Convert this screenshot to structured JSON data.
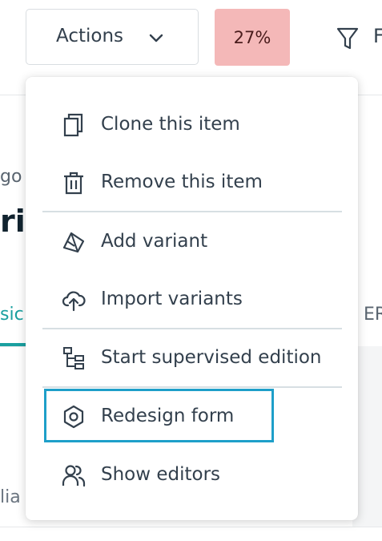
{
  "toolbar": {
    "actions_label": "Actions",
    "completion": "27%",
    "filter_label": "F",
    "completion_color": "#f4b8b8"
  },
  "background": {
    "breadcrumb": "go c",
    "title": "ri",
    "tab_active": "sic",
    "tab_right": "ER",
    "field": "lia"
  },
  "menu": {
    "items": [
      {
        "label": "Clone this item",
        "icon": "clone-icon"
      },
      {
        "label": "Remove this item",
        "icon": "trash-icon"
      },
      {
        "label": "Add variant",
        "icon": "variant-icon"
      },
      {
        "label": "Import variants",
        "icon": "cloud-upload-icon"
      },
      {
        "label": "Start supervised edition",
        "icon": "hierarchy-icon"
      },
      {
        "label": "Redesign form",
        "icon": "hexagon-icon"
      },
      {
        "label": "Show editors",
        "icon": "users-icon"
      }
    ],
    "highlight_color": "#1e9fc9"
  }
}
